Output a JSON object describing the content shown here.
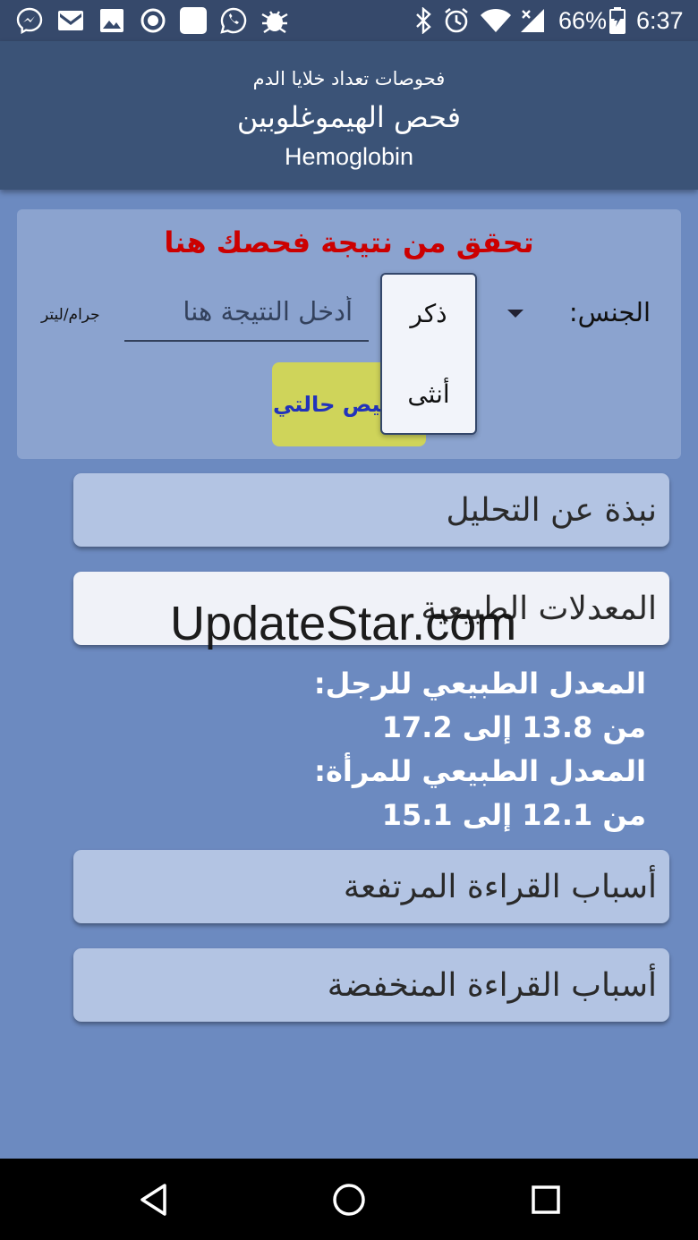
{
  "status_bar": {
    "battery": "66%",
    "time": "6:37",
    "icons": [
      "messenger-icon",
      "gmail-icon",
      "gallery-icon",
      "record-icon",
      "square-app-icon",
      "whatsapp-icon",
      "bug-icon",
      "bluetooth-icon",
      "alarm-icon",
      "wifi-icon",
      "signal-icon",
      "battery-icon"
    ]
  },
  "header": {
    "subtitle": "فحوصات تعداد خلايا الدم",
    "title": "فحص الهيموغلوبين",
    "title_en": "Hemoglobin"
  },
  "check_card": {
    "title": "تحقق من نتيجة فحصك هنا",
    "gender_label": "الجنس:",
    "result_placeholder": "أدخل النتيجة هنا",
    "unit": "جرام/ليتر",
    "diagnose_button": "تشخيص حالتي",
    "gender_options": [
      "ذكر",
      "أنثى"
    ]
  },
  "sections": {
    "about": "نبذة عن التحليل",
    "normal_ranges": "المعدلات الطبيعية",
    "high_causes": "أسباب القراءة المرتفعة",
    "low_causes": "أسباب القراءة المنخفضة"
  },
  "normal_values": {
    "male_label": "المعدل الطبيعي للرجل:",
    "male_range": "من 13.8 إلى 17.2",
    "female_label": "المعدل الطبيعي للمرأة:",
    "female_range": "من 12.1 إلى 15.1"
  },
  "watermark": "UpdateStar.com",
  "colors": {
    "app_bar": "#3b5377",
    "background": "#6c8ac0",
    "title_red": "#cc0000",
    "button_yellow": "#cfd45a",
    "button_text_blue": "#2233bb"
  }
}
